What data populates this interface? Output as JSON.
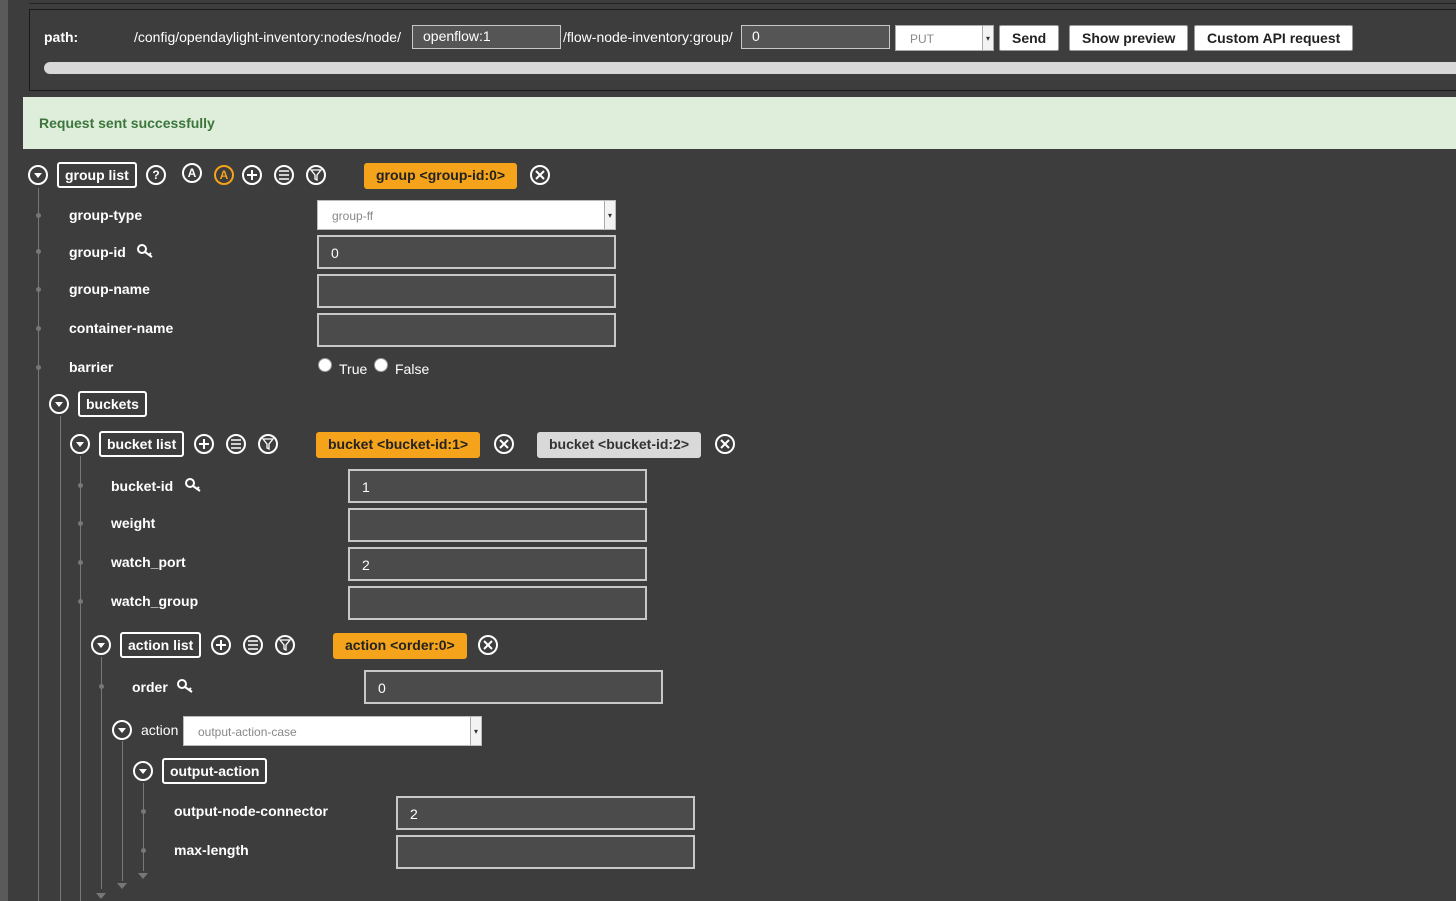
{
  "header": {
    "path_label": "path:",
    "path_prefix": "/config/opendaylight-inventory:nodes/node/",
    "node_value": "openflow:1",
    "path_middle": "/flow-node-inventory:group/",
    "group_value": "0",
    "method": "PUT",
    "send_label": "Send",
    "preview_label": "Show preview",
    "custom_label": "Custom API request"
  },
  "status": {
    "message": "Request sent successfully"
  },
  "group_list": {
    "label": "group list",
    "help": "?",
    "a1": "A",
    "a2": "A",
    "active_tag": "group  <group-id:0>"
  },
  "group": {
    "type_label": "group-type",
    "type_value": "group-ff",
    "id_label": "group-id",
    "id_value": "0",
    "name_label": "group-name",
    "name_value": "",
    "container_label": "container-name",
    "container_value": "",
    "barrier_label": "barrier",
    "barrier_true": "True",
    "barrier_false": "False"
  },
  "buckets": {
    "label": "buckets",
    "list_label": "bucket list",
    "tag1": "bucket  <bucket-id:1>",
    "tag2": "bucket  <bucket-id:2>",
    "id_label": "bucket-id",
    "id_value": "1",
    "weight_label": "weight",
    "weight_value": "",
    "watch_port_label": "watch_port",
    "watch_port_value": "2",
    "watch_group_label": "watch_group",
    "watch_group_value": ""
  },
  "actions": {
    "list_label": "action list",
    "tag": "action  <order:0>",
    "order_label": "order",
    "order_value": "0",
    "action_label": "action",
    "action_value": "output-action-case",
    "output_label": "output-action",
    "connector_label": "output-node-connector",
    "connector_value": "2",
    "max_len_label": "max-length",
    "max_len_value": ""
  },
  "colors": {
    "accent": "#f5a31a",
    "success_bg": "#deeedb",
    "success_text": "#3c763d",
    "bg": "#3d3d3d"
  }
}
